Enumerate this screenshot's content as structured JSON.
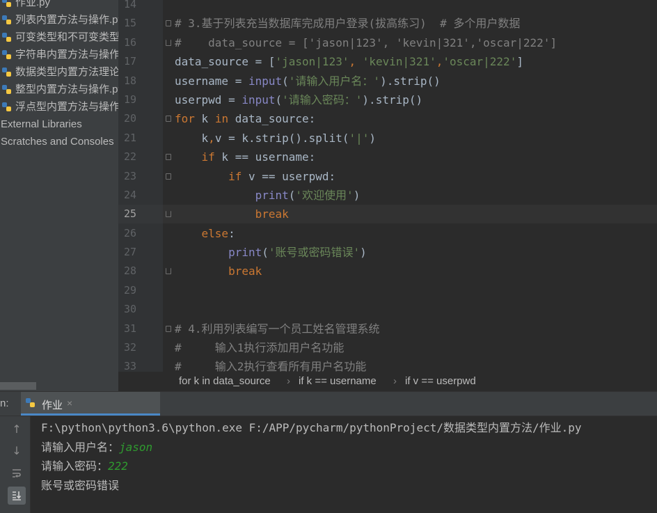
{
  "project_tree": {
    "items": [
      {
        "label": "作业.py",
        "type": "file"
      },
      {
        "label": "列表内置方法与操作.py",
        "type": "file"
      },
      {
        "label": "可变类型和不可变类型.py",
        "type": "file"
      },
      {
        "label": "字符串内置方法与操作.py",
        "type": "file"
      },
      {
        "label": "数据类型内置方法理论.py",
        "type": "file"
      },
      {
        "label": "整型内置方法与操作.py",
        "type": "file"
      },
      {
        "label": "浮点型内置方法与操作.py",
        "type": "file"
      },
      {
        "label": "External Libraries",
        "type": "folder"
      },
      {
        "label": "Scratches and Consoles",
        "type": "folder"
      }
    ]
  },
  "editor": {
    "current_line": 25,
    "lines": [
      {
        "n": "14",
        "text": ""
      },
      {
        "n": "15",
        "text": "# 3.基于列表充当数据库完成用户登录(拔高练习)  # 多个用户数据"
      },
      {
        "n": "16",
        "text": "#    data_source = ['jason|123', 'kevin|321','oscar|222']"
      },
      {
        "n": "17",
        "text": "data_source = ['jason|123', 'kevin|321','oscar|222']"
      },
      {
        "n": "18",
        "text": "username = input('请输入用户名：').strip()"
      },
      {
        "n": "19",
        "text": "userpwd = input('请输入密码：').strip()"
      },
      {
        "n": "20",
        "text": "for k in data_source:"
      },
      {
        "n": "21",
        "text": "    k,v = k.strip().split('|')"
      },
      {
        "n": "22",
        "text": "    if k == username:"
      },
      {
        "n": "23",
        "text": "        if v == userpwd:"
      },
      {
        "n": "24",
        "text": "            print('欢迎使用')"
      },
      {
        "n": "25",
        "text": "            break"
      },
      {
        "n": "26",
        "text": "    else:"
      },
      {
        "n": "27",
        "text": "        print('账号或密码错误')"
      },
      {
        "n": "28",
        "text": "        break"
      },
      {
        "n": "29",
        "text": ""
      },
      {
        "n": "30",
        "text": ""
      },
      {
        "n": "31",
        "text": "# 4.利用列表编写一个员工姓名管理系统"
      },
      {
        "n": "32",
        "text": "#     输入1执行添加用户名功能"
      },
      {
        "n": "33",
        "text": "#     输入2执行查看所有用户名功能"
      }
    ]
  },
  "breadcrumbs": [
    "for k in data_source",
    "if k == username",
    "if v == userpwd"
  ],
  "breadcrumb_separator": "›",
  "run_panel": {
    "label": "n:",
    "tab_label": "作业",
    "tab_close": "×",
    "console": {
      "command": "F:\\python\\python3.6\\python.exe F:/APP/pycharm/pythonProject/数据类型内置方法/作业.py",
      "prompt_user": "请输入用户名：",
      "input_user": "jason",
      "prompt_pwd": "请输入密码：",
      "input_pwd": "222",
      "output": "账号或密码错误"
    }
  },
  "colors": {
    "keyword": "#cc7832",
    "string": "#6a8759",
    "comment": "#808080",
    "builtin": "#8888c6",
    "user_input": "#2f9b2f"
  }
}
